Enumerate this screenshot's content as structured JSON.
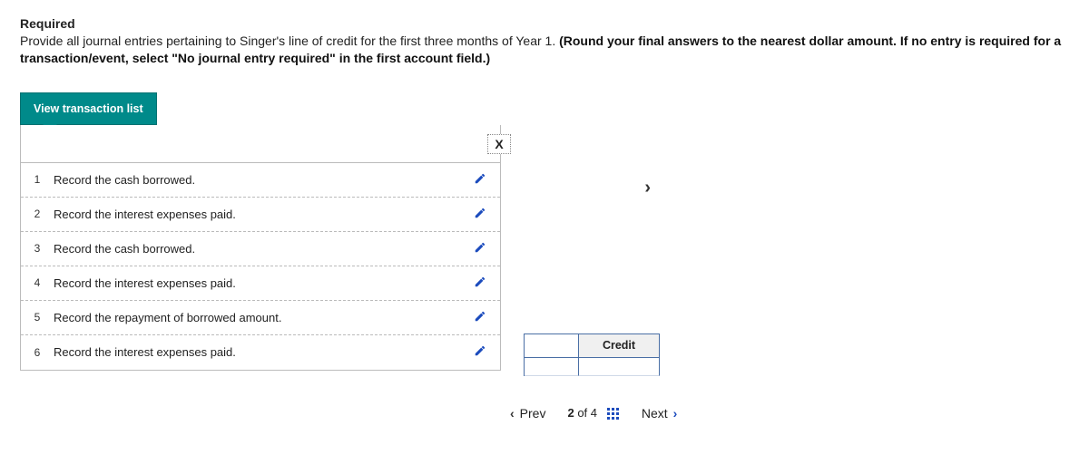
{
  "required": {
    "heading": "Required",
    "body_plain": "Provide all journal entries pertaining to Singer's line of credit for the first three months of Year 1. ",
    "body_bold": "(Round your final answers to the nearest dollar amount. If no entry is required for a transaction/event, select \"No journal entry required\" in the first account field.)"
  },
  "tab_label": "View transaction list",
  "close_glyph": "X",
  "chevron_glyph": "›",
  "transactions": {
    "items": [
      {
        "n": "1",
        "desc": "Record the cash borrowed."
      },
      {
        "n": "2",
        "desc": "Record the interest expenses paid."
      },
      {
        "n": "3",
        "desc": "Record the cash borrowed."
      },
      {
        "n": "4",
        "desc": "Record the interest expenses paid."
      },
      {
        "n": "5",
        "desc": "Record the repayment of borrowed amount."
      },
      {
        "n": "6",
        "desc": "Record the interest expenses paid."
      }
    ]
  },
  "entry_table": {
    "col2": "Credit"
  },
  "pager": {
    "prev": "Prev",
    "next": "Next",
    "current": "2",
    "of": "of",
    "total": "4",
    "prev_chev": "‹",
    "next_chev": "›"
  }
}
